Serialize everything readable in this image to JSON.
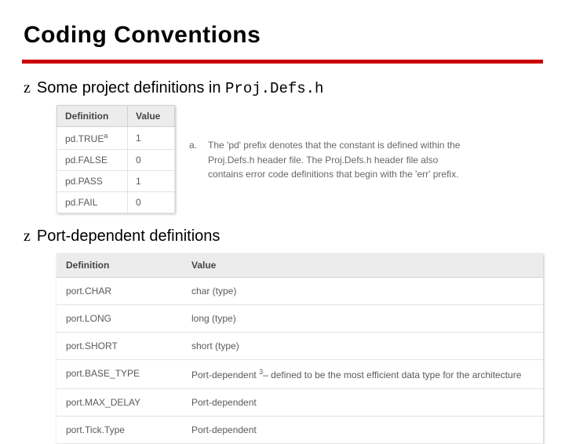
{
  "title": "Coding Conventions",
  "bullet1": {
    "marker": "z",
    "text_prefix": "Some project definitions in ",
    "code": "Proj.Defs.h"
  },
  "table1": {
    "headers": [
      "Definition",
      "Value"
    ],
    "rows": [
      {
        "def": "pd.TRUE",
        "sup": "a",
        "val": "1"
      },
      {
        "def": "pd.FALSE",
        "sup": "",
        "val": "0"
      },
      {
        "def": "pd.PASS",
        "sup": "",
        "val": "1"
      },
      {
        "def": "pd.FAIL",
        "sup": "",
        "val": "0"
      }
    ]
  },
  "footnote1": {
    "key": "a.",
    "text": "The 'pd' prefix denotes that the constant is defined within the Proj.Defs.h header file. The Proj.Defs.h header file also contains error code definitions that begin with the 'err' prefix."
  },
  "bullet2": {
    "marker": "z",
    "text": "Port-dependent definitions"
  },
  "table2": {
    "headers": [
      "Definition",
      "Value"
    ],
    "rows": [
      {
        "def": "port.CHAR",
        "val": "char (type)"
      },
      {
        "def": "port.LONG",
        "val": "long (type)"
      },
      {
        "def": "port.SHORT",
        "val": "short (type)"
      },
      {
        "def": "port.BASE_TYPE",
        "val": "Port-dependent ",
        "sup": "3",
        "tail": "– defined to be the most efficient data type for the architecture"
      },
      {
        "def": "port.MAX_DELAY",
        "val": "Port-dependent"
      },
      {
        "def": "port.Tick.Type",
        "val": "Port-dependent"
      }
    ]
  }
}
